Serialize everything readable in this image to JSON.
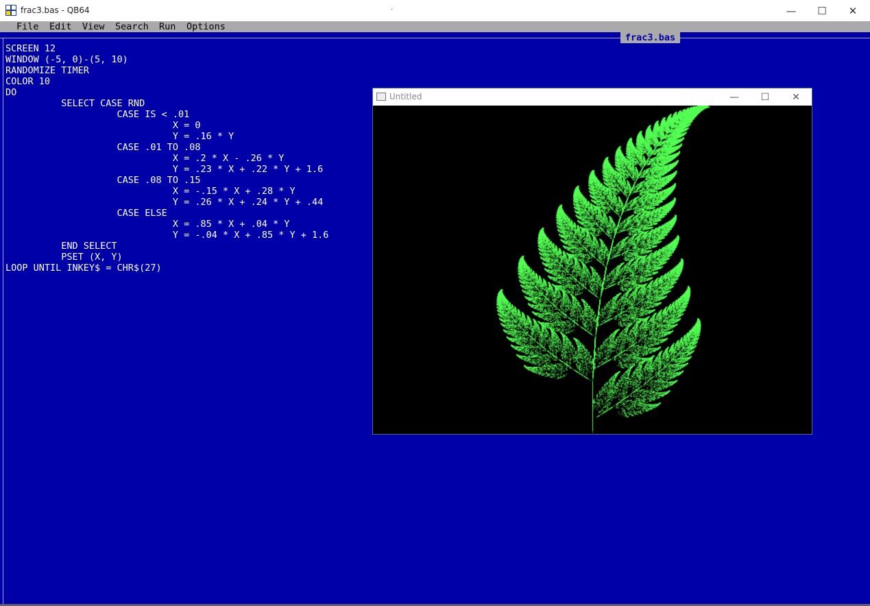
{
  "window": {
    "title": "frac3.bas - QB64",
    "minimize": "—",
    "maximize": "☐",
    "close": "✕"
  },
  "menu": {
    "items": [
      "File",
      "Edit",
      "View",
      "Search",
      "Run",
      "Options"
    ]
  },
  "editor": {
    "file_tab": "frac3.bas",
    "code_lines": [
      "SCREEN 12",
      "WINDOW (-5, 0)-(5, 10)",
      "RANDOMIZE TIMER",
      "COLOR 10",
      "DO",
      "          SELECT CASE RND",
      "                    CASE IS < .01",
      "                              X = 0",
      "                              Y = .16 * Y",
      "                    CASE .01 TO .08",
      "                              X = .2 * X - .26 * Y",
      "                              Y = .23 * X + .22 * Y + 1.6",
      "                    CASE .08 TO .15",
      "                              X = -.15 * X + .28 * Y",
      "                              Y = .26 * X + .24 * Y + .44",
      "                    CASE ELSE",
      "                              X = .85 * X + .04 * Y",
      "                              Y = -.04 * X + .85 * Y + 1.6",
      "          END SELECT",
      "          PSET (X, Y)",
      "LOOP UNTIL INKEY$ = CHR$(27)"
    ]
  },
  "output_window": {
    "title": "Untitled",
    "minimize": "—",
    "maximize": "☐",
    "close": "✕"
  },
  "colors": {
    "editor_bg": "#0000a8",
    "fern": "#55ff55"
  }
}
